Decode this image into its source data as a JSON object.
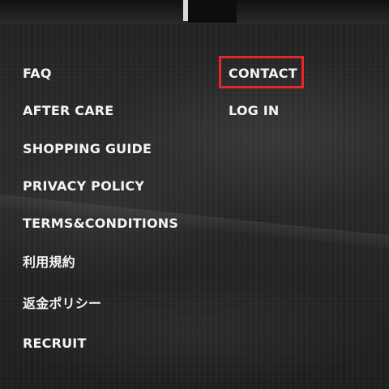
{
  "footer_menu": {
    "left_column": [
      {
        "label": "FAQ"
      },
      {
        "label": "AFTER CARE"
      },
      {
        "label": "SHOPPING GUIDE"
      },
      {
        "label": "PRIVACY POLICY"
      },
      {
        "label": "TERMS&CONDITIONS"
      },
      {
        "label": "利用規約"
      },
      {
        "label": "返金ポリシー"
      },
      {
        "label": "RECRUIT"
      }
    ],
    "right_column": [
      {
        "label": "CONTACT"
      },
      {
        "label": "LOG IN"
      }
    ]
  },
  "highlight": {
    "target": "CONTACT",
    "color": "#e5262a"
  },
  "colors": {
    "text": "#f4f4f4",
    "background": "#242424"
  }
}
